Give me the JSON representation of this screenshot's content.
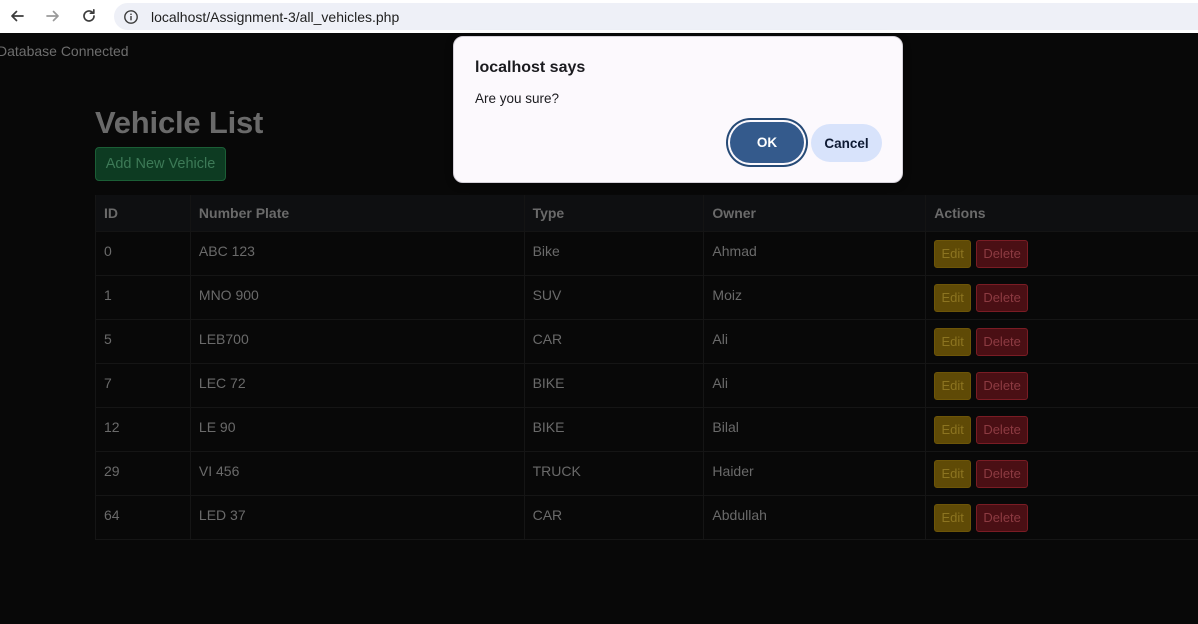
{
  "browser": {
    "url_host": "localhost",
    "url_path": "/Assignment-3/all_vehicles.php"
  },
  "page": {
    "db_status": "Database Connected",
    "title": "Vehicle List",
    "add_button_label": "Add New Vehicle"
  },
  "table": {
    "headers": [
      "ID",
      "Number Plate",
      "Type",
      "Owner",
      "Actions"
    ],
    "rows": [
      {
        "id": "0",
        "plate": "ABC 123",
        "type": "Bike",
        "owner": "Ahmad"
      },
      {
        "id": "1",
        "plate": "MNO 900",
        "type": "SUV",
        "owner": "Moiz"
      },
      {
        "id": "5",
        "plate": "LEB700",
        "type": "CAR",
        "owner": "Ali"
      },
      {
        "id": "7",
        "plate": "LEC 72",
        "type": "BIKE",
        "owner": "Ali"
      },
      {
        "id": "12",
        "plate": "LE 90",
        "type": "BIKE",
        "owner": "Bilal"
      },
      {
        "id": "29",
        "plate": "VI 456",
        "type": "TRUCK",
        "owner": "Haider"
      },
      {
        "id": "64",
        "plate": "LED 37",
        "type": "CAR",
        "owner": "Abdullah"
      }
    ],
    "edit_label": "Edit",
    "delete_label": "Delete"
  },
  "dialog": {
    "title": "localhost says",
    "message": "Are you sure?",
    "ok_label": "OK",
    "cancel_label": "Cancel"
  },
  "icons": {
    "back": "arrow-left-icon",
    "forward": "arrow-right-icon",
    "reload": "reload-icon",
    "site_info": "info-circle-icon"
  }
}
